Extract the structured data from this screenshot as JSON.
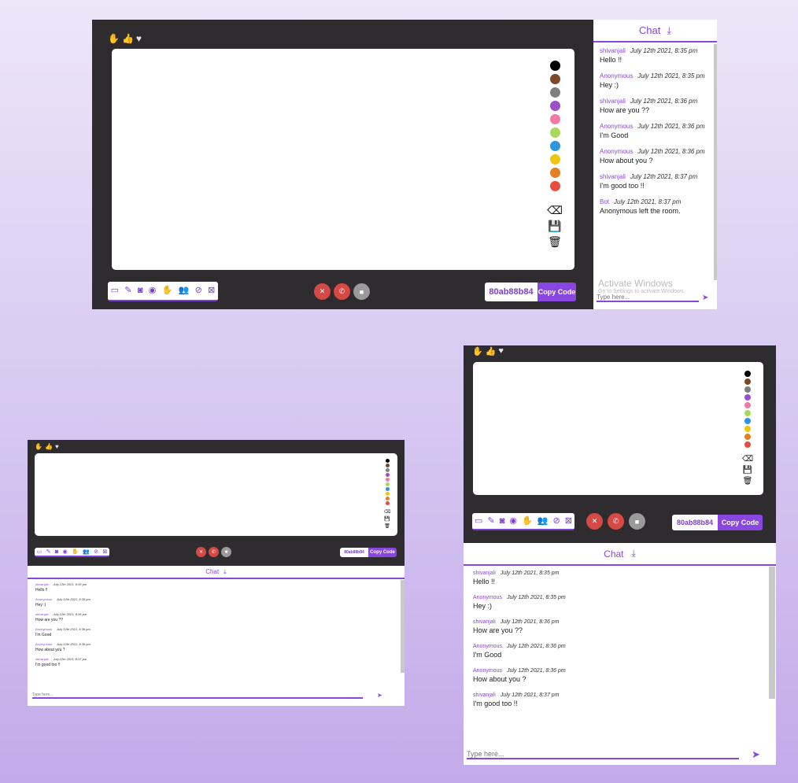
{
  "reactions": [
    {
      "icon": "raise-hand-icon",
      "glyph": "✋"
    },
    {
      "icon": "thumbs-up-icon",
      "glyph": "👍"
    },
    {
      "icon": "heart-icon",
      "glyph": "♥"
    }
  ],
  "palette_colors": [
    "#000000",
    "#7a4a2b",
    "#7f7f7f",
    "#9b4fc8",
    "#f07aa6",
    "#a8d95a",
    "#2b96dd",
    "#f1c40f",
    "#e67e22",
    "#e74c3c"
  ],
  "board_tools": [
    {
      "icon": "eraser-icon",
      "glyph": "⌫"
    },
    {
      "icon": "save-icon",
      "glyph": "💾"
    },
    {
      "icon": "trash-icon",
      "glyph": "🗑"
    }
  ],
  "toolbar_icons": [
    {
      "icon": "screen-share-icon",
      "glyph": "▭"
    },
    {
      "icon": "whiteboard-icon",
      "glyph": "✎"
    },
    {
      "icon": "camera-icon",
      "glyph": "◙"
    },
    {
      "icon": "record-icon",
      "glyph": "◉"
    },
    {
      "icon": "hand-icon",
      "glyph": "✋"
    },
    {
      "icon": "participants-icon",
      "glyph": "👥"
    },
    {
      "icon": "mic-off-icon",
      "glyph": "⊘"
    },
    {
      "icon": "video-off-icon",
      "glyph": "⊠"
    }
  ],
  "media_buttons": [
    {
      "icon": "mic-muted-icon",
      "glyph": "✕",
      "color": "#d64a45"
    },
    {
      "icon": "hangup-icon",
      "glyph": "✆",
      "color": "#d64a45"
    },
    {
      "icon": "video-icon",
      "glyph": "■",
      "color": "#9a9a9a"
    }
  ],
  "room": {
    "code": "80ab88b84",
    "copy_label": "Copy Code"
  },
  "chat": {
    "title": "Chat",
    "placeholder": "Type here...",
    "messages": [
      {
        "user": "shivanjali",
        "time": "July 12th 2021, 8:35 pm",
        "text": "Hello !!"
      },
      {
        "user": "Anonymous",
        "time": "July 12th 2021, 8:35 pm",
        "text": "Hey :)"
      },
      {
        "user": "shivanjali",
        "time": "July 12th 2021, 8:36 pm",
        "text": "How are you ??"
      },
      {
        "user": "Anonymous",
        "time": "July 12th 2021, 8:36 pm",
        "text": "I'm Good"
      },
      {
        "user": "Anonymous",
        "time": "July 12th 2021, 8:36 pm",
        "text": "How about you ?"
      },
      {
        "user": "shivanjali",
        "time": "July 12th 2021, 8:37 pm",
        "text": "I'm good too !!"
      },
      {
        "user": "Bot",
        "time": "July 12th 2021, 8:37 pm",
        "text": "Anonymous left the room."
      }
    ]
  },
  "watermark": {
    "title": "Activate Windows",
    "subtitle": "Go to Settings to activate Windows."
  }
}
